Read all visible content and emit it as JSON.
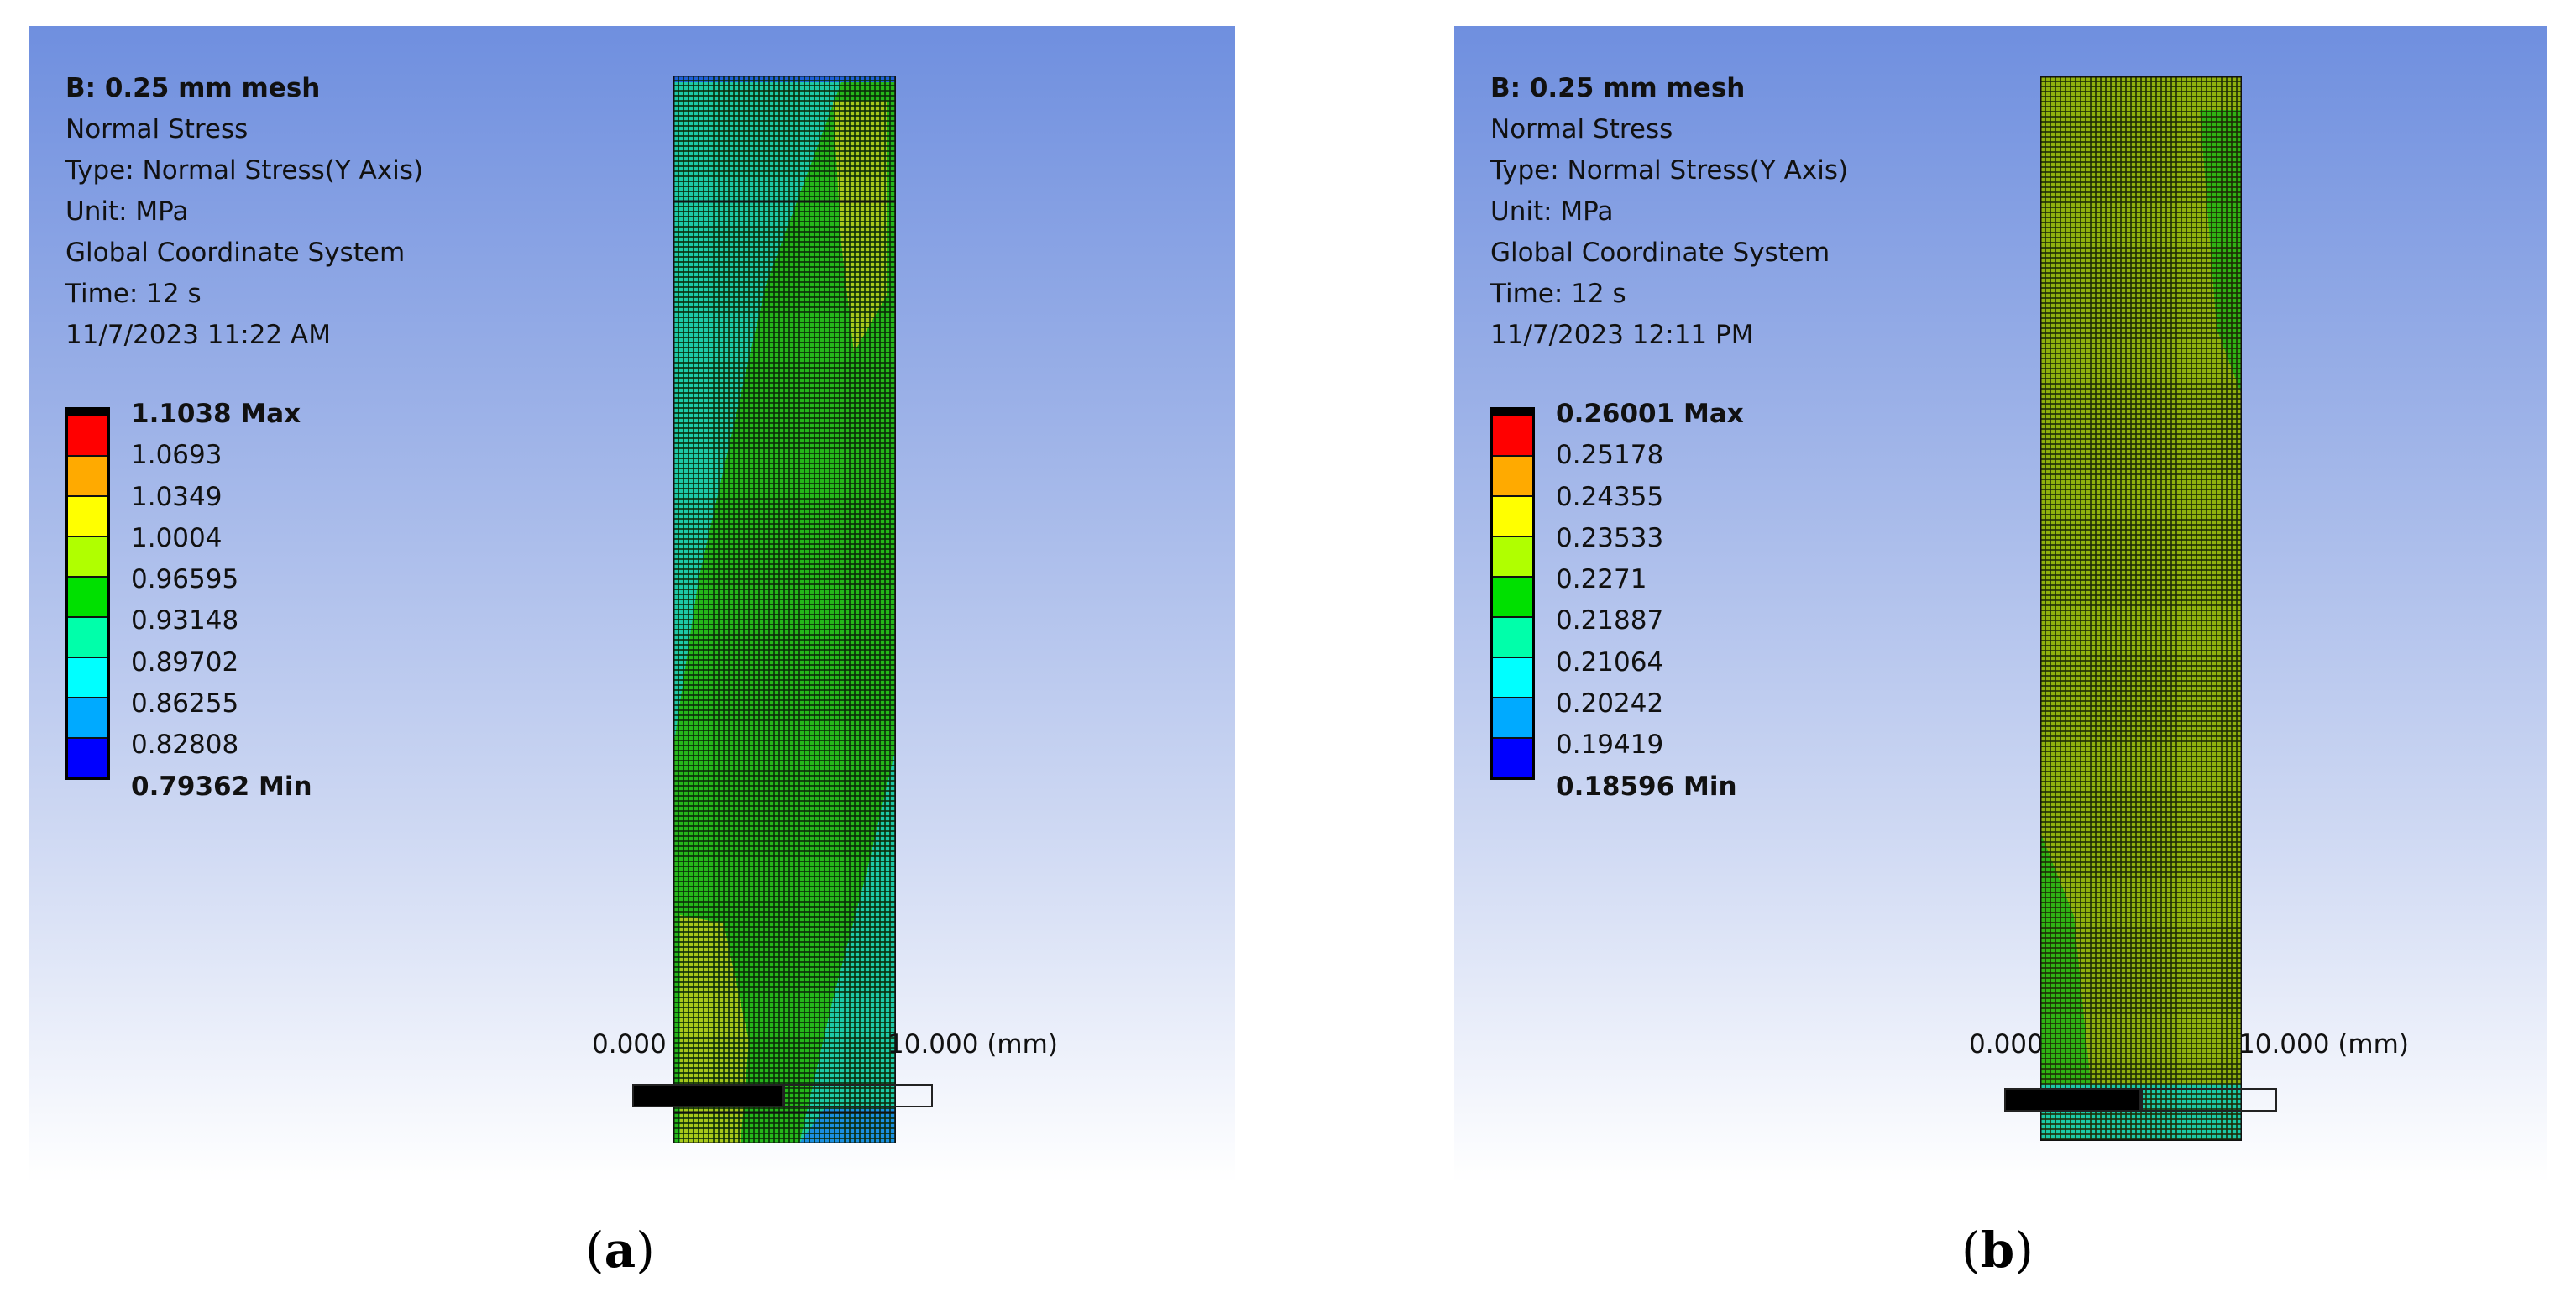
{
  "legend_colors": [
    "#ff0000",
    "#ffaa00",
    "#ffff00",
    "#b0ff00",
    "#00e000",
    "#00ffaa",
    "#00ffff",
    "#00aaff",
    "#0000ff"
  ],
  "panels": [
    {
      "title": "B: 0.25 mm mesh",
      "result": "Normal Stress",
      "type": "Type: Normal Stress(Y Axis)",
      "unit": "Unit: MPa",
      "coord": "Global Coordinate System",
      "time": "Time: 12 s",
      "datetime": "11/7/2023 11:22 AM",
      "legend": {
        "max": "1.1038 Max",
        "values": [
          "1.0693",
          "1.0349",
          "1.0004",
          "0.96595",
          "0.93148",
          "0.89702",
          "0.86255",
          "0.82808"
        ],
        "min": "0.79362 Min"
      },
      "scale": {
        "start": "0.000",
        "end": "10.000 (mm)"
      },
      "caption_open": "(",
      "caption_letter": "a",
      "caption_close": ")"
    },
    {
      "title": "B: 0.25 mm mesh",
      "result": "Normal Stress",
      "type": "Type: Normal Stress(Y Axis)",
      "unit": "Unit: MPa",
      "coord": "Global Coordinate System",
      "time": "Time: 12 s",
      "datetime": "11/7/2023 12:11 PM",
      "legend": {
        "max": "0.26001 Max",
        "values": [
          "0.25178",
          "0.24355",
          "0.23533",
          "0.2271",
          "0.21887",
          "0.21064",
          "0.20242",
          "0.19419"
        ],
        "min": "0.18596 Min"
      },
      "scale": {
        "start": "0.000",
        "end": "10.000 (mm)"
      },
      "caption_open": "(",
      "caption_letter": "b",
      "caption_close": ")"
    }
  ]
}
